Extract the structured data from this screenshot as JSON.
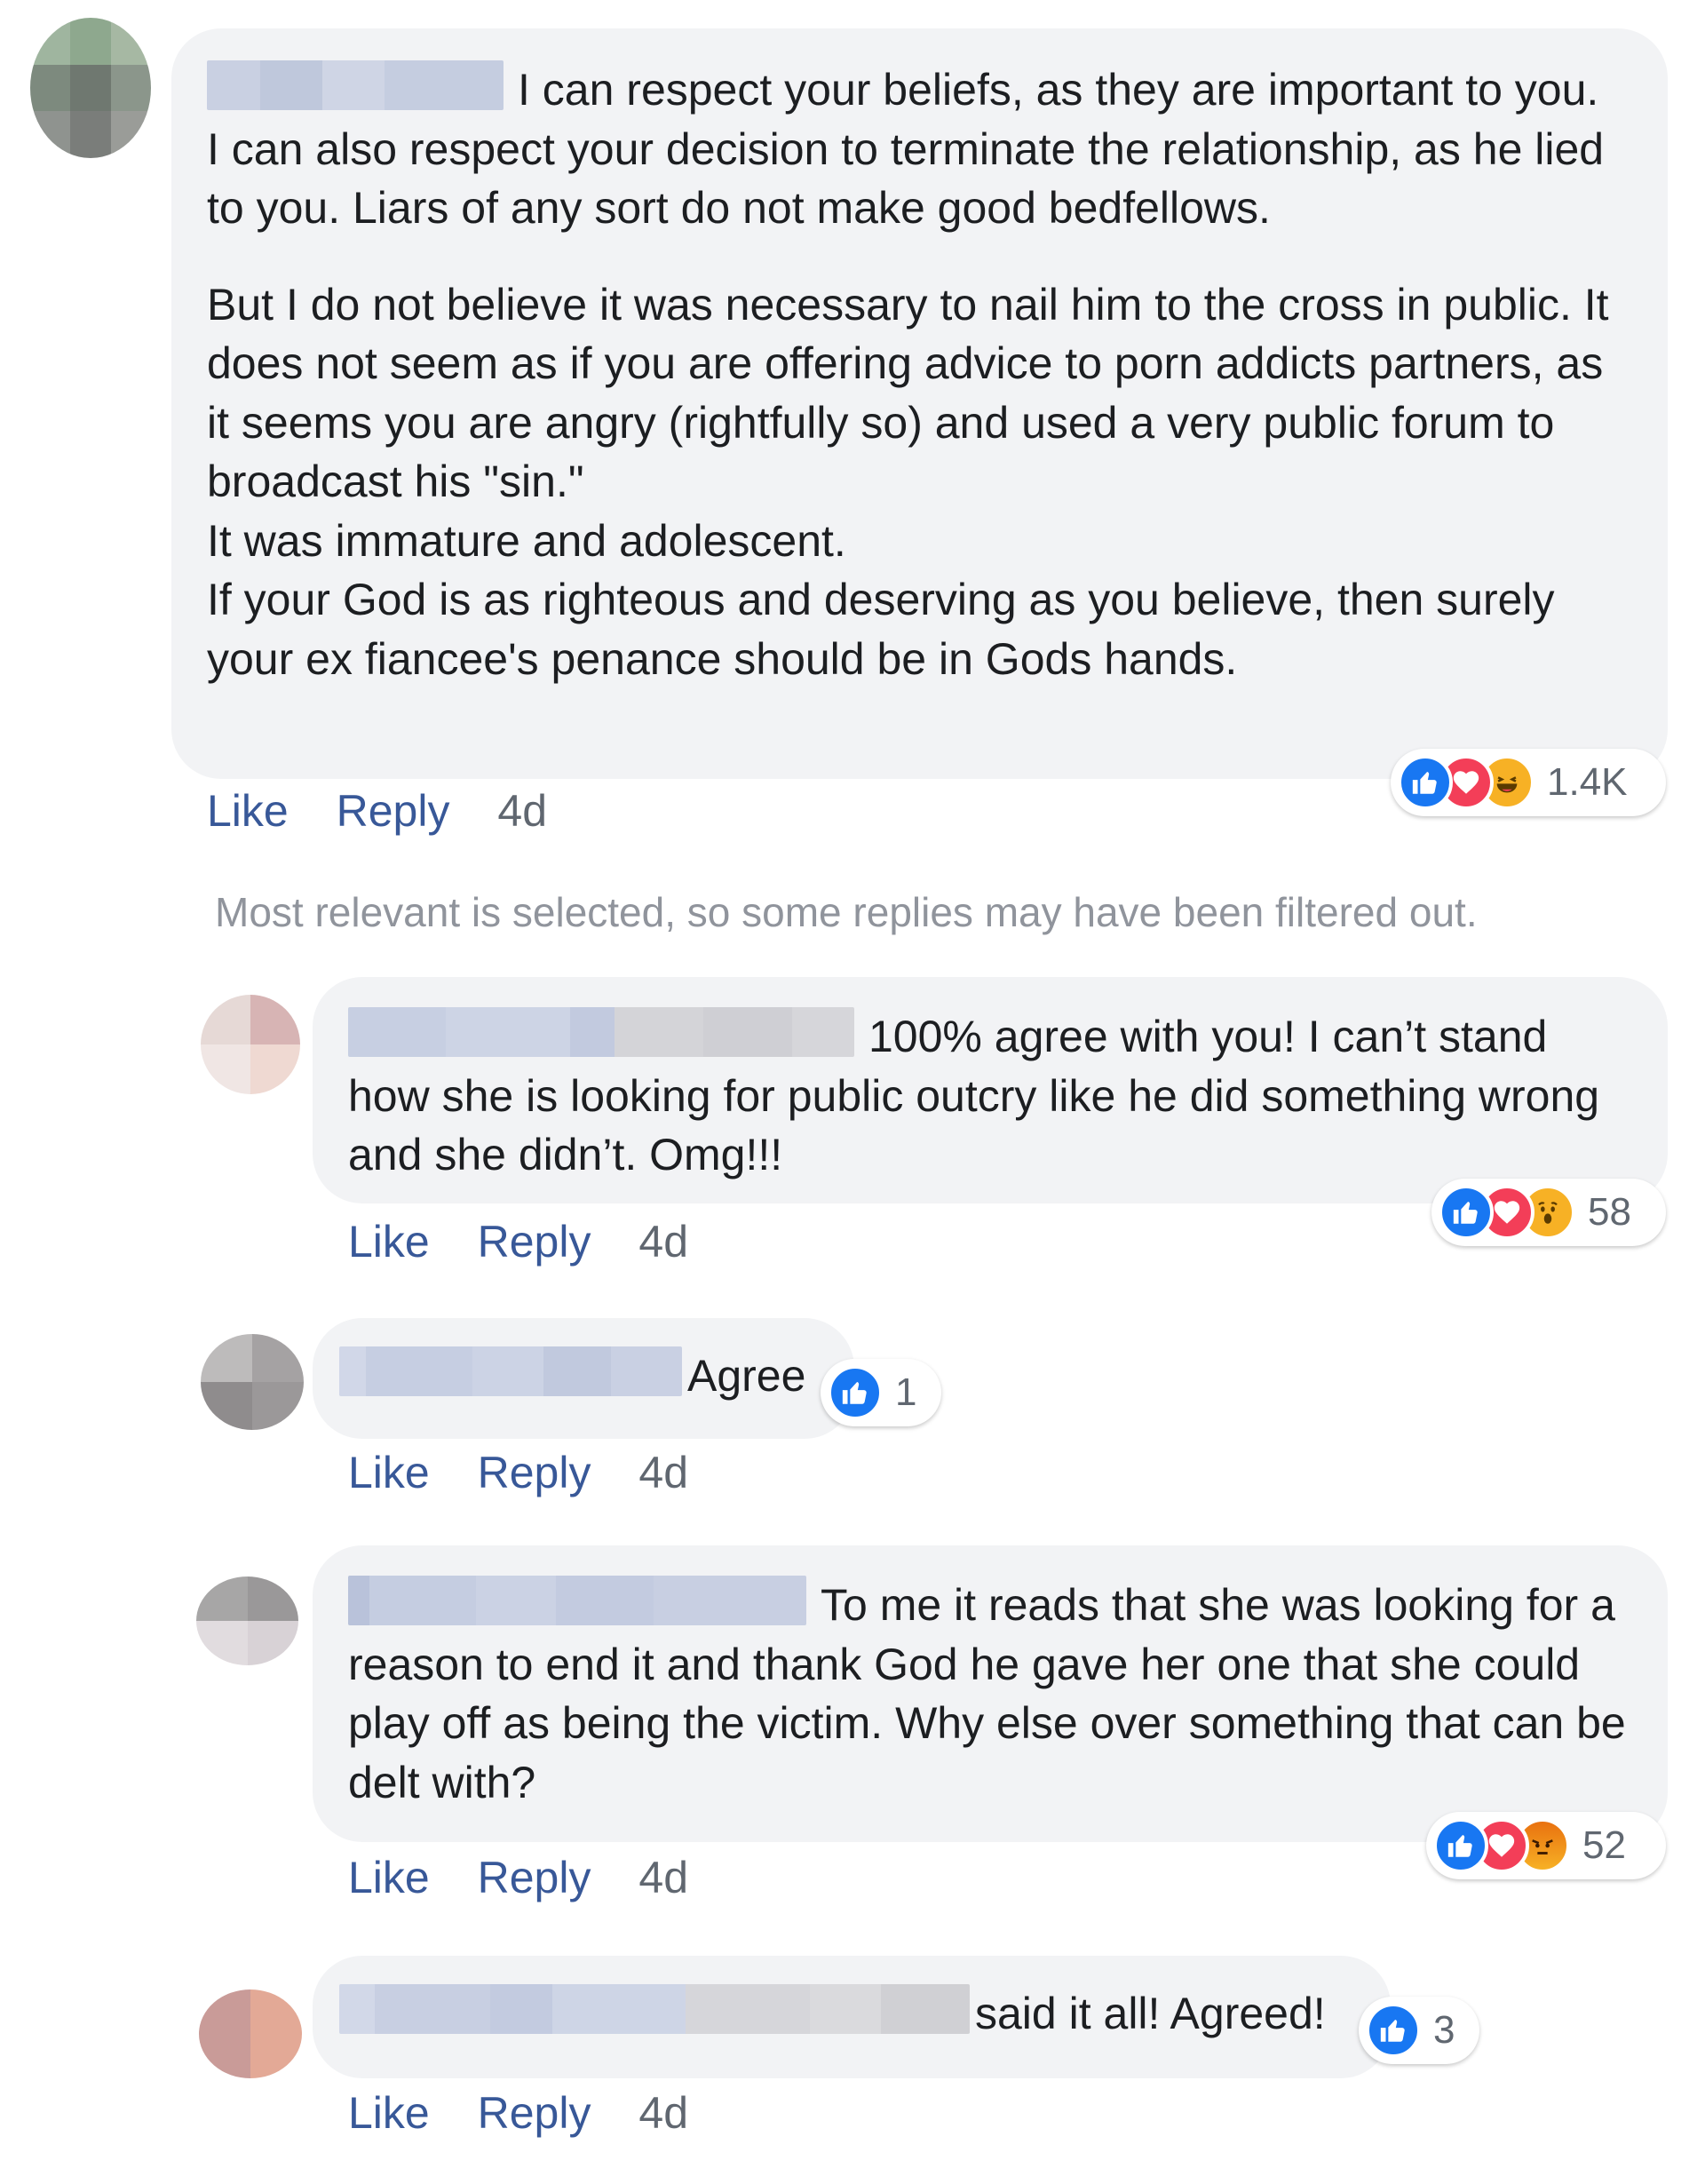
{
  "main_comment": {
    "lines_para1": [
      "I can respect your beliefs, as they are important to you.",
      "I can also respect your decision to terminate the relationship, as he lied to you. Liars of any sort do not make good bedfellows."
    ],
    "lines_para2": [
      "But I do not believe it was necessary to nail him to the cross in public. It does not seem as if you are offering advice to porn addicts partners, as it seems you are angry (rightfully so) and used a very public forum to broadcast his \"sin.\"",
      "It was immature and adolescent.",
      "If your God is as righteous and deserving as you believe, then surely your ex fiancee's penance should be in Gods hands."
    ],
    "reactions": [
      "like",
      "love",
      "haha"
    ],
    "reaction_count": "1.4K",
    "like_label": "Like",
    "reply_label": "Reply",
    "time": "4d"
  },
  "filter_note": "Most relevant is selected, so some replies may have been filtered out.",
  "replies": [
    {
      "text": "100% agree with you! I can’t stand how she is looking for public outcry like he did something wrong and she didn’t. Omg!!!",
      "reactions": [
        "like",
        "love",
        "wow"
      ],
      "reaction_count": "58",
      "like_label": "Like",
      "reply_label": "Reply",
      "time": "4d"
    },
    {
      "text": "Agree",
      "reactions": [
        "like"
      ],
      "reaction_count": "1",
      "like_label": "Like",
      "reply_label": "Reply",
      "time": "4d"
    },
    {
      "text": "To me it reads that she was looking for a reason to end it and thank God he gave her one that she could play off as being the victim. Why else over something that can be delt with?",
      "reactions": [
        "like",
        "love",
        "angry"
      ],
      "reaction_count": "52",
      "like_label": "Like",
      "reply_label": "Reply",
      "time": "4d"
    },
    {
      "text": "said it all! Agreed!",
      "reactions": [
        "like"
      ],
      "reaction_count": "3",
      "like_label": "Like",
      "reply_label": "Reply",
      "time": "4d"
    }
  ],
  "colors": {
    "bubble_bg": "#f2f3f5",
    "link_blue": "#385898",
    "like_blue": "#1877f2",
    "love_red": "#f33e58",
    "emoji_yellow": "#f7b125",
    "meta_gray": "#606770"
  }
}
